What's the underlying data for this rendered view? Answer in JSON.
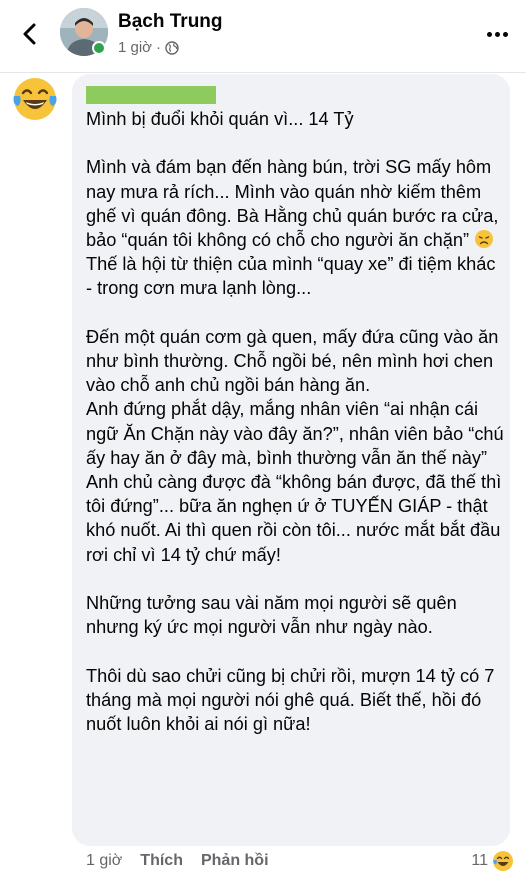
{
  "header": {
    "name": "Bạch Trung",
    "time": "1 giờ",
    "privacy_icon": "globe-icon",
    "back_icon": "chevron-left-icon",
    "more_icon": "more-horizontal-icon"
  },
  "comment": {
    "author_emoji": "laughing-tears-emoji",
    "redacted_name_color": "#8dcb5f",
    "paragraph_1": "Mình bị đuổi khỏi quán vì... 14 Tỷ",
    "paragraph_2a": "Mình và đám bạn đến hàng bún, trời SG mấy hôm nay mưa rả rích... Mình vào quán nhờ kiếm thêm ghế vì quán đông. Bà Hằng chủ quán bước ra cửa, bảo “quán tôi không có chỗ cho người ăn chặn”",
    "inline_emoji": "disappointed-face-emoji",
    "paragraph_2b": "Thế là hội từ thiện của mình “quay xe” đi tiệm khác - trong cơn mưa lạnh lòng...",
    "paragraph_3": "Đến một quán cơm gà quen, mấy đứa cũng vào ăn như bình thường. Chỗ ngồi bé, nên mình hơi chen vào chỗ anh chủ ngồi bán hàng ăn.\nAnh đứng phắt dậy, mắng nhân viên “ai nhận cái ngữ Ăn Chặn này vào đây ăn?”, nhân viên bảo “chú ấy hay ăn ở đây mà, bình thường vẫn ăn thế này” Anh chủ càng được đà “không bán được, đã thế thì tôi đứng”... bữa ăn nghẹn ứ ở TUYẾN GIÁP - thật khó nuốt. Ai thì quen rồi còn tôi... nước mắt bắt đầu rơi chỉ vì 14 tỷ chứ mấy!",
    "paragraph_4": "Những tưởng sau vài năm mọi người sẽ quên nhưng ký ức mọi người vẫn như ngày nào.",
    "paragraph_5": "Thôi dù sao chửi cũng bị chửi rồi, mượn 14 tỷ có 7 tháng mà mọi người nói ghê quá. Biết thế, hồi đó nuốt luôn khỏi ai nói gì nữa!"
  },
  "footer": {
    "time": "1 giờ",
    "like_label": "Thích",
    "reply_label": "Phản hồi",
    "reaction_count": "11",
    "reaction_icon": "laughing-emoji"
  }
}
